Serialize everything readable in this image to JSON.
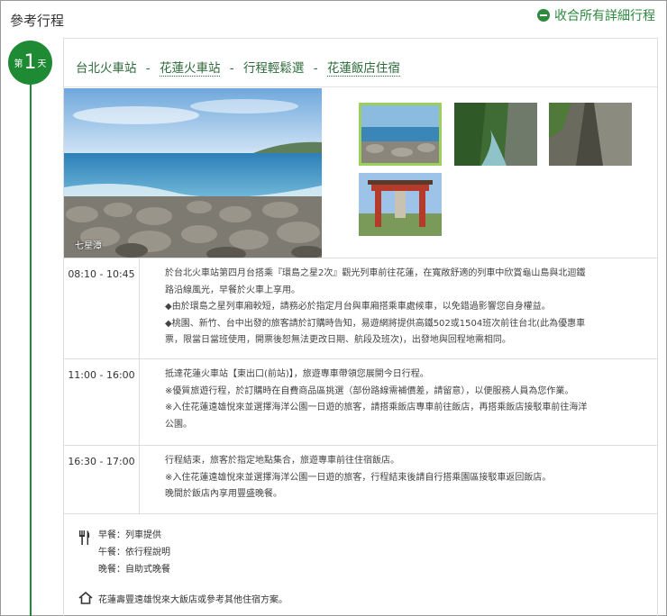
{
  "header": {
    "section_title": "參考行程",
    "collapse_label": "收合所有詳細行程"
  },
  "day": {
    "prefix": "第",
    "number": "1",
    "suffix": "天",
    "route": [
      "台北火車站",
      "花蓮火車站",
      "行程輕鬆選",
      "花蓮飯店住宿"
    ],
    "route_sep": "-"
  },
  "photo": {
    "caption": "七星潭"
  },
  "schedule": [
    {
      "time": "08:10 - 10:45",
      "lines": [
        "於台北火車站第四月台搭乘『環島之星2次』觀光列車前往花蓮，在寬敞舒適的列車中欣賞龜山島與北迴鐵",
        "路沿線風光，早餐於火車上享用。",
        "◆由於環島之星列車廂較短，請務必於指定月台與車廂搭乘車處候車，以免錯過影響您自身權益。",
        "◆桃園、新竹、台中出發的旅客請於訂購時告知，易遊網將提供高鐵502或1504班次前往台北(此為優惠車",
        "票，限當日當班使用，開票後恕無法更改日期、航段及班次)，出發地與回程地需相同。"
      ]
    },
    {
      "time": "11:00 - 16:00",
      "lines": [
        "抵達花蓮火車站【東出口(前站)】，旅遊專車帶領您展開今日行程。",
        "※優質旅遊行程，於訂購時在自費商品區挑選（部份路線需補價差，請留意），以便服務人員為您作業。",
        "※入住花蓮遠雄悅來並選擇海洋公園一日遊的旅客，請搭乘飯店專車前往飯店，再搭乘飯店接駁車前往海洋",
        "公園。"
      ]
    },
    {
      "time": "16:30 - 17:00",
      "lines": [
        "行程結束，旅客於指定地點集合，旅遊專車前往住宿飯店。",
        "※入住花蓮遠雄悅來並選擇海洋公園一日遊的旅客，行程結束後請自行搭乘園區接駁車返回飯店。",
        "晚間於飯店內享用豐盛晚餐。"
      ]
    }
  ],
  "meals": {
    "breakfast": "早餐：列車提供",
    "lunch": "午餐：依行程說明",
    "dinner": "晚餐：自助式晚餐"
  },
  "hotel": {
    "text": "花蓮壽豐遠雄悅來大飯店或參考其他住宿方案。"
  },
  "icons": {
    "collapse": "minus-circle-icon",
    "meal": "fork-knife-icon",
    "hotel": "house-icon"
  },
  "colors": {
    "brand_green": "#1f8a34",
    "link_green": "#2d6b3a",
    "active_thumb_border": "#9bd15b"
  }
}
